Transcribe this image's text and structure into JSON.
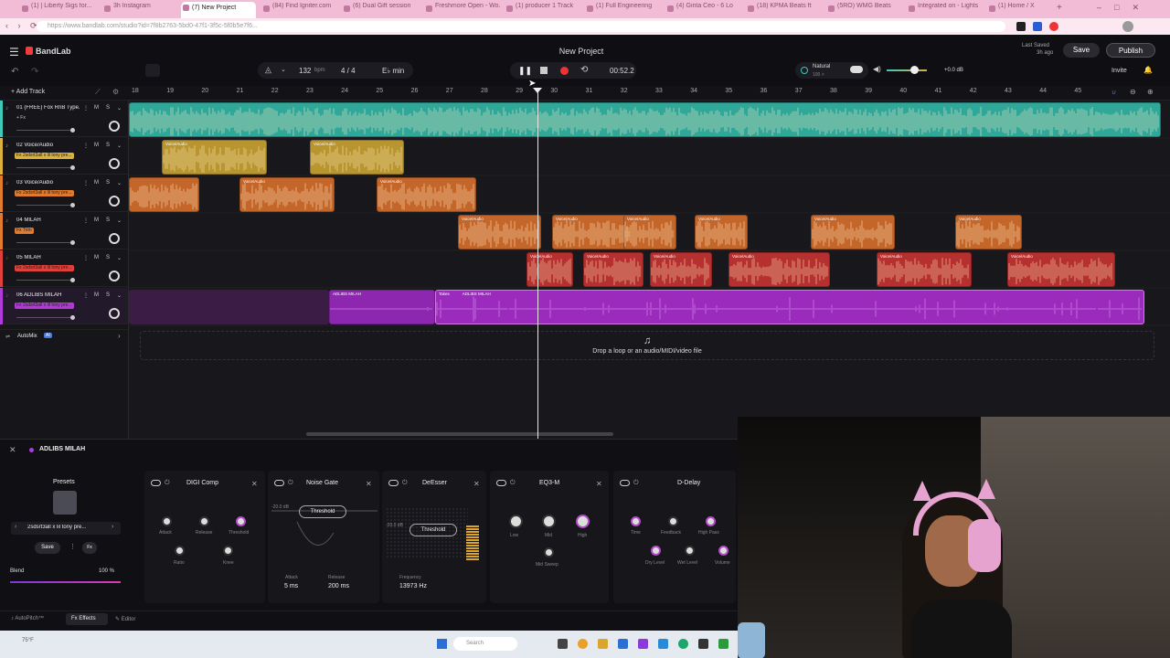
{
  "browser": {
    "tabs": [
      {
        "label": "(1) | Liberty Sigs for..."
      },
      {
        "label": "3h Instagram"
      },
      {
        "label": "(7) New Project"
      },
      {
        "label": "(84) Find Igniter.com"
      },
      {
        "label": "(6) Dual Gift session"
      },
      {
        "label": "Freshmore Open - Wo..."
      },
      {
        "label": "(1) producer 1 Track"
      },
      {
        "label": "(1) Full Engineering"
      },
      {
        "label": "(4) Ginta Ceo - 6 Lo"
      },
      {
        "label": "(18) KPMA Beats ft"
      },
      {
        "label": "(5RO) WMG Beats"
      },
      {
        "label": "Integrated on - Lights"
      },
      {
        "label": "(1) Home / X"
      }
    ],
    "url": "https://www.bandlab.com/studio?id=7f8b2763-5bd0-47f1-3f5c-5f0b5e7f6..."
  },
  "app": {
    "brand": "BandLab",
    "project_title": "New Project",
    "last_saved_label": "Last Saved",
    "last_saved_time": "3h ago",
    "save_label": "Save",
    "publish_label": "Publish",
    "invite_label": "Invite",
    "tempo": "132",
    "tempo_unit": "bpm",
    "time_signature": "4 / 4",
    "key": "E♭ min",
    "time": "00:52.2",
    "preset_name": "Natural",
    "preset_sub": "100 >",
    "master_volume": "+0.0 dB"
  },
  "ruler": {
    "ticks": [
      "18",
      "19",
      "20",
      "21",
      "22",
      "23",
      "24",
      "25",
      "26",
      "27",
      "28",
      "29",
      "30",
      "31",
      "32",
      "33",
      "34",
      "35",
      "36",
      "37",
      "38",
      "39",
      "40",
      "41",
      "42",
      "43",
      "44",
      "45"
    ]
  },
  "tracks": [
    {
      "name": "01 (FREE) Fox RnB Type...",
      "fx": "+ Fx",
      "color": "#3ec9b8"
    },
    {
      "name": "02 Voice/Audio",
      "fx": "Fx 2sdsrt3all x lil tony pre...",
      "color": "#d9b13b"
    },
    {
      "name": "03 Voice/Audio",
      "fx": "Fx 2sdsrt3all x lil tony pre...",
      "color": "#e07a2c"
    },
    {
      "name": "04 MILAH",
      "fx": "Fx Trim",
      "color": "#e07a2c"
    },
    {
      "name": "05 MILAH",
      "fx": "Fx 2sdsrt3all x lil tony pre...",
      "color": "#e0403a"
    },
    {
      "name": "06 ADLIBS MILAH",
      "fx": "Fx 2sdsrt3all x lil tony pre...",
      "color": "#b23ad9"
    }
  ],
  "track_buttons": {
    "m": "M",
    "s": "S"
  },
  "add_track_label": "Add Track",
  "automix_label": "AutoMix",
  "automix_badge": "AI",
  "clip_labels": {
    "voice": "Voice/Audio",
    "adlibs": "ADLIBS MILAH",
    "takes": "Takes"
  },
  "drop_zone_text": "Drop a loop or an audio/MIDI/video file",
  "fx_panel": {
    "track_name": "ADLIBS MILAH",
    "presets_label": "Presets",
    "preset_name": "2sdsrt3all x lil tony pre...",
    "save_label": "Save",
    "fx_button": "Fx",
    "blend_label": "Blend",
    "blend_value": "100 %",
    "blend_level": 1.0,
    "effects": [
      {
        "title": "DIGI Comp",
        "knobs": [
          "Attack",
          "Release",
          "Threshold",
          "Ratio",
          "Knee"
        ]
      },
      {
        "title": "Noise Gate",
        "threshold": "Threshold",
        "db": "-20.0 dB",
        "attack_label": "Attack",
        "attack_value": "5 ms",
        "release_label": "Release",
        "release_value": "200 ms"
      },
      {
        "title": "DeEsser",
        "threshold": "Threshold",
        "db": "-20.0 dB",
        "freq_label": "Frequency",
        "freq_value": "13973 Hz"
      },
      {
        "title": "EQ3-M",
        "knobs": [
          "Low",
          "Mid",
          "High",
          "Mid Sweep"
        ]
      },
      {
        "title": "D-Delay",
        "knobs": [
          "Time",
          "Feedback",
          "High Pass",
          "Dry Level",
          "Wet Level",
          "Volume"
        ]
      }
    ],
    "bottom_tabs": [
      "AutoPitch™",
      "Effects",
      "Editor"
    ]
  },
  "taskbar": {
    "search_placeholder": "Search",
    "weather": "75°F"
  }
}
